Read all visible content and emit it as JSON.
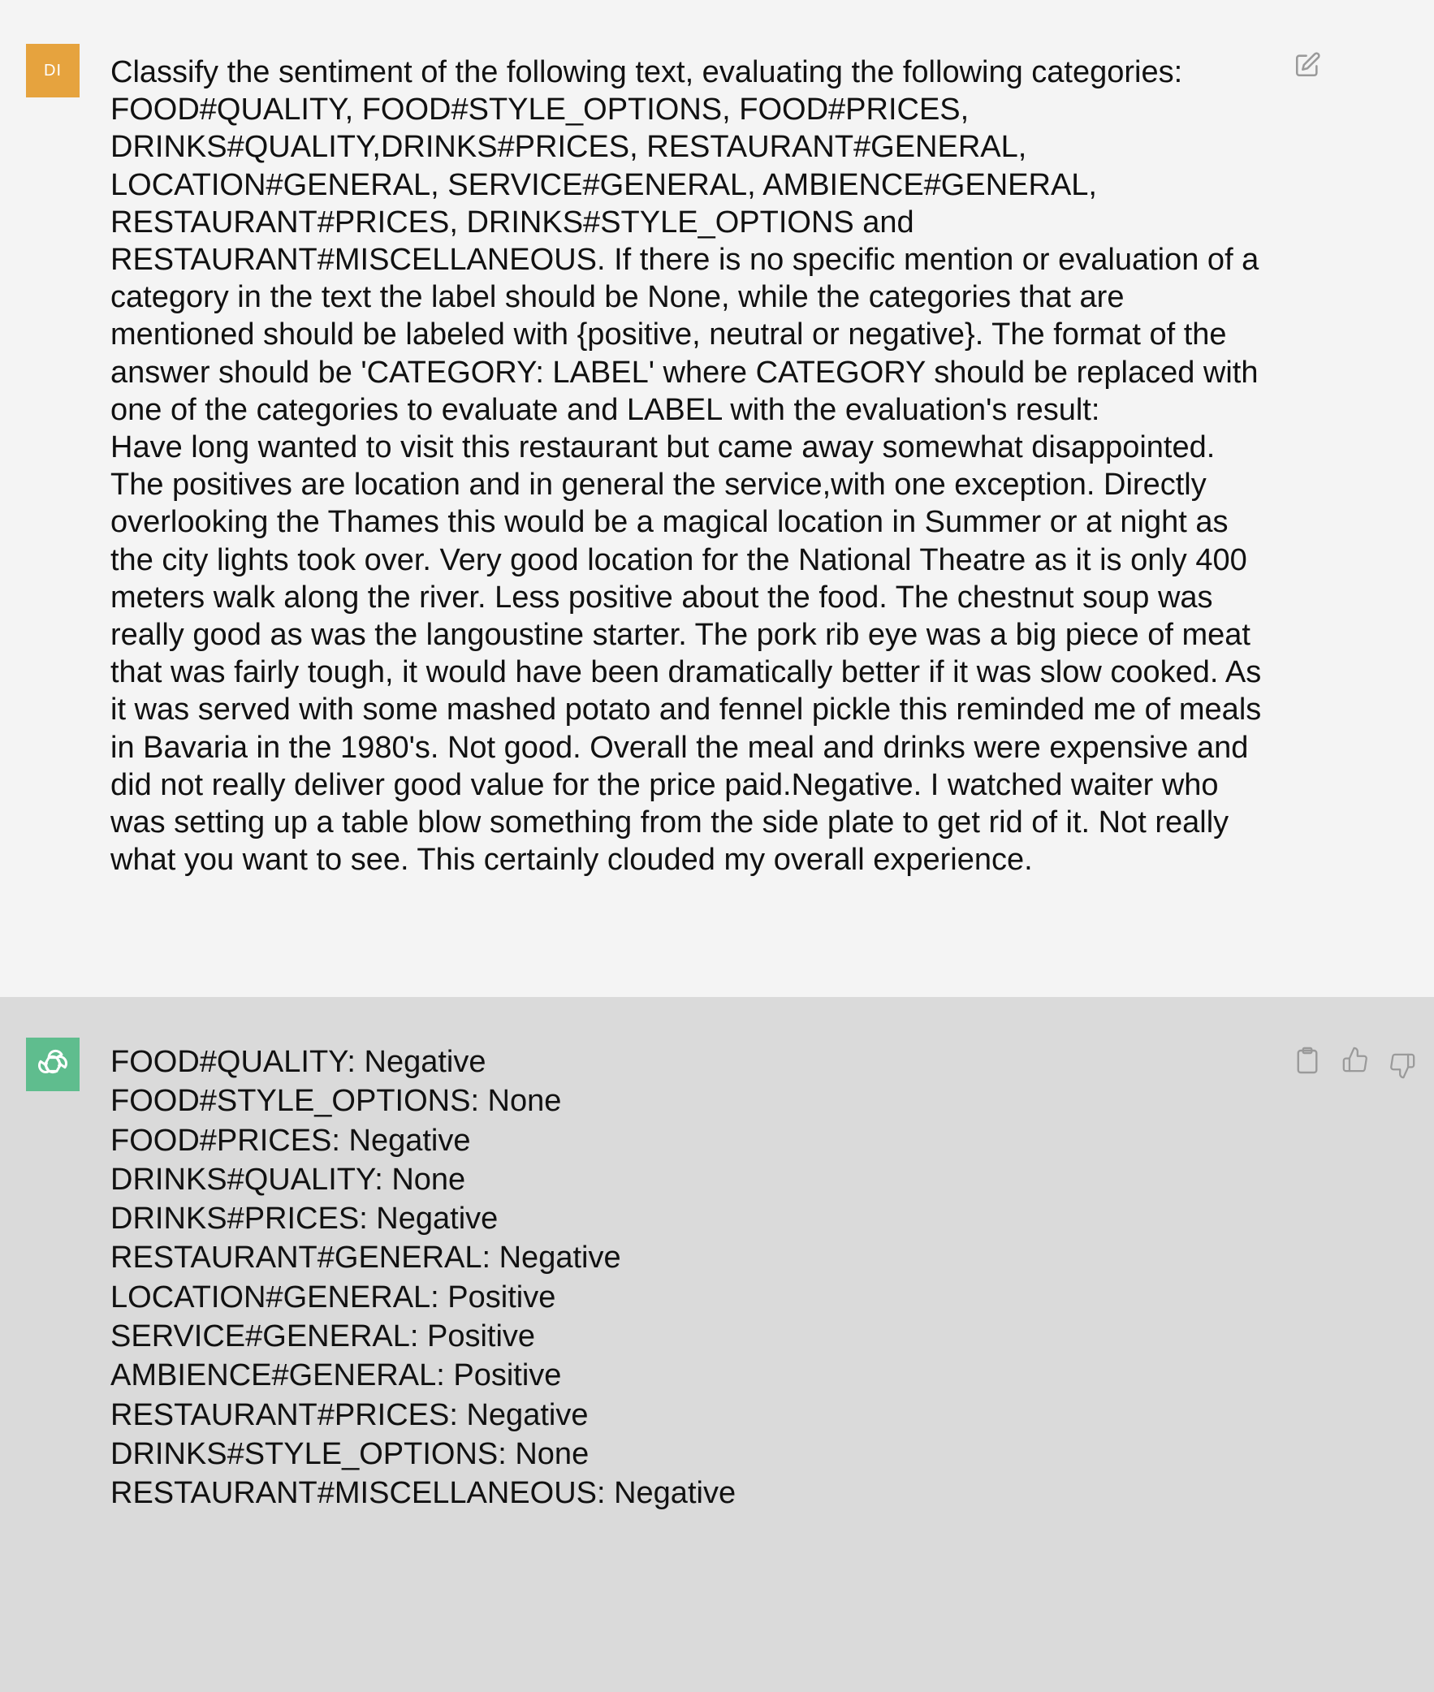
{
  "user_message": {
    "avatar_initials": "DI",
    "avatar_color": "#e6a33e",
    "text": "Classify the sentiment of the following text, evaluating the following categories: FOOD#QUALITY, FOOD#STYLE_OPTIONS, FOOD#PRICES, DRINKS#QUALITY,DRINKS#PRICES, RESTAURANT#GENERAL, LOCATION#GENERAL, SERVICE#GENERAL, AMBIENCE#GENERAL, RESTAURANT#PRICES, DRINKS#STYLE_OPTIONS and RESTAURANT#MISCELLANEOUS. If there is no specific mention or evaluation of a category in the text the label should be None, while the categories that are mentioned should be labeled with {positive, neutral or negative}. The format of the answer should be 'CATEGORY: LABEL' where CATEGORY should be replaced with one of the categories to evaluate and LABEL with the evaluation's result:\nHave long wanted to visit this restaurant but came away somewhat disappointed. The positives are location and in general the service,with one exception. Directly overlooking the Thames this would be a magical location in Summer or at night as the city lights took over. Very good location for the National Theatre as it is only 400 meters walk along the river. Less positive about the food. The chestnut soup was really good as was the langoustine starter. The pork rib eye was a big piece of meat that was fairly tough, it would have been dramatically better if it was slow cooked. As it was served with some mashed potato and fennel pickle this reminded me of meals in Bavaria in the 1980's. Not good. Overall the meal and drinks were expensive and did not really deliver good value for the price paid.Negative. I watched waiter who was setting up a table blow something from the side plate to get rid of it. Not really what you want to see. This certainly clouded my overall experience.",
    "edit_icon": "edit-icon"
  },
  "assistant_message": {
    "avatar_icon": "openai-logo-icon",
    "avatar_color": "#5fbd8e",
    "lines": [
      "FOOD#QUALITY: Negative",
      "FOOD#STYLE_OPTIONS: None",
      "FOOD#PRICES: Negative",
      "DRINKS#QUALITY: None",
      "DRINKS#PRICES: Negative",
      "RESTAURANT#GENERAL: Negative",
      "LOCATION#GENERAL: Positive",
      "SERVICE#GENERAL: Positive",
      "AMBIENCE#GENERAL: Positive",
      "RESTAURANT#PRICES: Negative",
      "DRINKS#STYLE_OPTIONS: None",
      "RESTAURANT#MISCELLANEOUS: Negative"
    ],
    "action_icons": [
      "copy-icon",
      "thumbs-up-icon",
      "thumbs-down-icon"
    ]
  },
  "colors": {
    "user_bg": "#f4f4f4",
    "assistant_bg": "#dadada",
    "icon_gray": "#9a9a9a"
  }
}
